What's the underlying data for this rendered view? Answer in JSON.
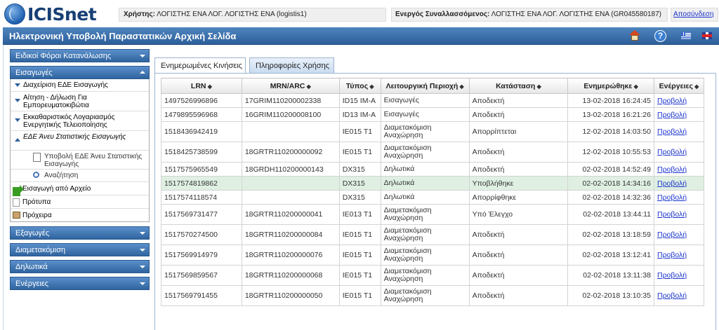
{
  "header": {
    "logo_text": "ICISnet",
    "user_label": "Χρήστης:",
    "user_value": "ΛΟΓΙΣΤΗΣ ΕΝΑ ΛΟΓ. ΛΟΓΙΣΤΗΣ ΕΝΑ (logistis1)",
    "trader_label": "Ενεργός Συναλλασσόμενος:",
    "trader_value": "ΛΟΓΙΣΤΗΣ ΕΝΑ ΛΟΓ. ΛΟΓΙΣΤΗΣ ΕΝΑ (GR045580187)",
    "logout": "Αποσύνδεση"
  },
  "titlebar": {
    "title": "Ηλεκτρονική Υποβολή Παραστατικών Αρχική Σελίδα",
    "icons": [
      "home-icon",
      "help-icon",
      "flag-greek-icon",
      "flag-english-icon"
    ]
  },
  "sidebar": {
    "excise": "Ειδικοί Φόροι Κατανάλωσης",
    "imports": "Εισαγωγές",
    "import_items": [
      {
        "label": "Διαχείριση ΕΔΕ Εισαγωγής"
      },
      {
        "label": "Αίτηση - Δήλωση Για Εμπορευματοκιβώτια"
      },
      {
        "label": "Εκκαθαριστικός Λογαριασμός Ενεργητικής Τελειοποίησης"
      },
      {
        "label": "ΕΔΕ Άνευ Στατιστικής Εισαγωγής"
      }
    ],
    "sub_items": [
      {
        "label": "Υποβολή ΕΔΕ Άνευ Στατιστικής Εισαγωγής"
      },
      {
        "label": "Αναζήτηση"
      }
    ],
    "misc_items": [
      {
        "label": "Εισαγωγή από Αρχείο"
      },
      {
        "label": "Πρότυπα"
      },
      {
        "label": "Πρόχειρα"
      }
    ],
    "exports": "Εξαγωγές",
    "transit": "Διαμετακόμιση",
    "declarations": "Δηλωτικά",
    "actions": "Ενέργειες"
  },
  "tabs": {
    "updated": "Ενημερωμένες Κινήσεις",
    "info": "Πληροφορίες Χρήσης"
  },
  "table": {
    "columns": [
      "LRN",
      "MRN/ARC",
      "Τύπος",
      "Λειτουργική Περιοχή",
      "Κατάσταση",
      "Ενημερώθηκε",
      "Ενέργειες"
    ],
    "sort_symbol": "◆",
    "rows": [
      {
        "lrn": "1497526996896",
        "mrn": "17GRIM110200002338",
        "type": "ID15 IM-A",
        "area1": "Εισαγωγές",
        "area2": "",
        "status": "Αποδεκτή",
        "updated": "13-02-2018 16:24:45",
        "action": "Προβολή"
      },
      {
        "lrn": "1479895596968",
        "mrn": "16GRIM110200008100",
        "type": "ID13 IM-A",
        "area1": "Εισαγωγές",
        "area2": "",
        "status": "Αποδεκτή",
        "updated": "13-02-2018 16:21:26",
        "action": "Προβολή"
      },
      {
        "lrn": "1518436942419",
        "mrn": "",
        "type": "IE015 T1",
        "area1": "Διαμετακόμιση",
        "area2": "Αναχώρηση",
        "status": "Απορρίπτεται",
        "updated": "12-02-2018 14:03:50",
        "action": "Προβολή"
      },
      {
        "lrn": "1518425738599",
        "mrn": "18GRTR110200000092",
        "type": "IE015 T1",
        "area1": "Διαμετακόμιση",
        "area2": "Αναχώρηση",
        "status": "Αποδεκτή",
        "updated": "12-02-2018 10:55:53",
        "action": "Προβολή"
      },
      {
        "lrn": "1517575965549",
        "mrn": "18GRDH110200000143",
        "type": "DX315",
        "area1": "Δηλωτικά",
        "area2": "",
        "status": "Αποδεκτή",
        "updated": "02-02-2018 14:52:49",
        "action": "Προβολή"
      },
      {
        "lrn": "1517574819862",
        "mrn": "",
        "type": "DX315",
        "area1": "Δηλωτικά",
        "area2": "",
        "status": "Υποβλήθηκε",
        "updated": "02-02-2018 14:34:16",
        "action": "Προβολή"
      },
      {
        "lrn": "1517574118574",
        "mrn": "",
        "type": "DX315",
        "area1": "Δηλωτικά",
        "area2": "",
        "status": "Απορρίφθηκε",
        "updated": "02-02-2018 14:32:36",
        "action": "Προβολή"
      },
      {
        "lrn": "1517569731477",
        "mrn": "18GRTR110200000041",
        "type": "IE013 T1",
        "area1": "Διαμετακόμιση",
        "area2": "Αναχώρηση",
        "status": "Υπό Έλεγχο",
        "updated": "02-02-2018 13:44:11",
        "action": "Προβολή"
      },
      {
        "lrn": "1517570274500",
        "mrn": "18GRTR110200000084",
        "type": "IE015 T1",
        "area1": "Διαμετακόμιση",
        "area2": "Αναχώρηση",
        "status": "Αποδεκτή",
        "updated": "02-02-2018 13:18:59",
        "action": "Προβολή"
      },
      {
        "lrn": "1517569914979",
        "mrn": "18GRTR110200000076",
        "type": "IE015 T1",
        "area1": "Διαμετακόμιση",
        "area2": "Αναχώρηση",
        "status": "Αποδεκτή",
        "updated": "02-02-2018 13:12:41",
        "action": "Προβολή"
      },
      {
        "lrn": "1517569859567",
        "mrn": "18GRTR110200000068",
        "type": "IE015 T1",
        "area1": "Διαμετακόμιση",
        "area2": "Αναχώρηση",
        "status": "Αποδεκτή",
        "updated": "02-02-2018 13:11:38",
        "action": "Προβολή"
      },
      {
        "lrn": "1517569791455",
        "mrn": "18GRTR110200000050",
        "type": "IE015 T1",
        "area1": "Διαμετακόμιση",
        "area2": "Αναχώρηση",
        "status": "Αποδεκτή",
        "updated": "02-02-2018 13:10:35",
        "action": "Προβολή"
      }
    ]
  },
  "colors": {
    "title_bar": "#2d5f9a",
    "highlight_row": "#dff0e3",
    "link": "#1a33cc"
  }
}
